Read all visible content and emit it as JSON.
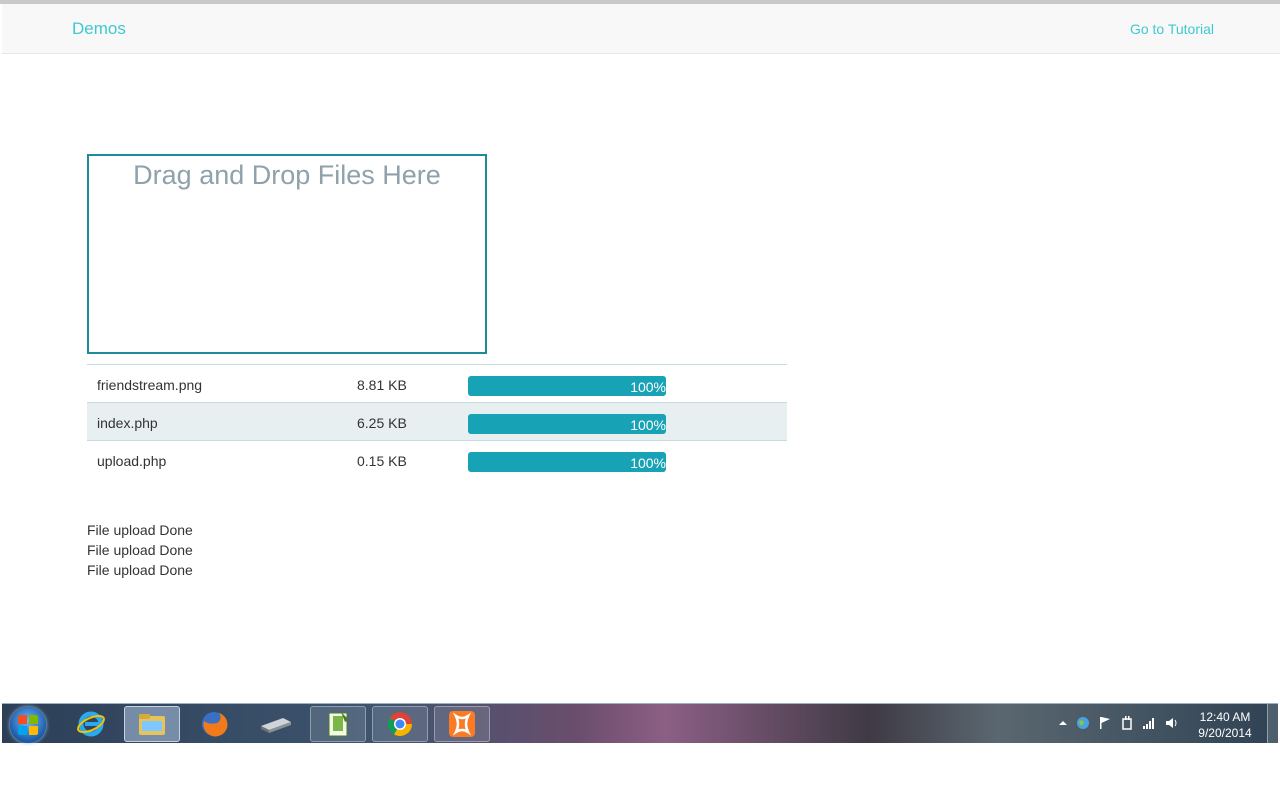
{
  "navbar": {
    "brand": "Demos",
    "tutorial_link": "Go to Tutorial"
  },
  "dropzone": {
    "title": "Drag and Drop Files Here"
  },
  "files": [
    {
      "name": "friendstream.png",
      "size": "8.81 KB",
      "progress_label": "100%",
      "progress": 1.0
    },
    {
      "name": "index.php",
      "size": "6.25 KB",
      "progress_label": "100%",
      "progress": 1.0
    },
    {
      "name": "upload.php",
      "size": "0.15 KB",
      "progress_label": "100%",
      "progress": 1.0
    }
  ],
  "status_messages": [
    "File upload Done",
    "File upload Done",
    "File upload Done"
  ],
  "colors": {
    "accent": "#3fc9cf",
    "progress": "#18a2b5",
    "dropzone_border": "#1f8a9a"
  },
  "taskbar": {
    "apps": [
      "internet-explorer-icon",
      "file-explorer-icon",
      "firefox-icon",
      "scanner-icon",
      "notepad-plus-plus-icon",
      "chrome-icon",
      "xampp-icon"
    ],
    "tray": [
      "show-hidden-icons-icon",
      "network-globe-icon",
      "action-center-flag-icon",
      "power-icon",
      "signal-bars-icon",
      "volume-icon"
    ],
    "clock": {
      "time": "12:40 AM",
      "date": "9/20/2014"
    }
  }
}
